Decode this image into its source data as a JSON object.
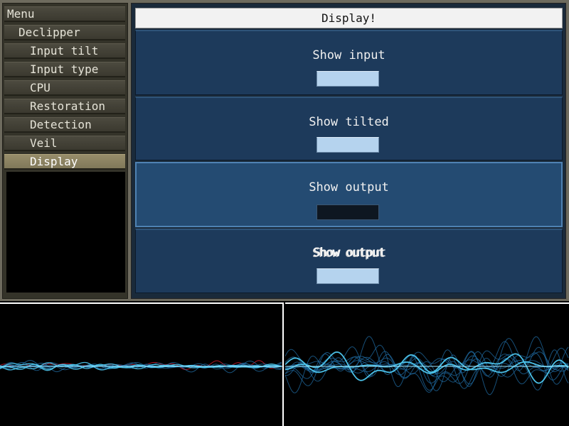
{
  "menu": {
    "items": [
      {
        "label": "Menu",
        "indent": 0,
        "selected": false
      },
      {
        "label": "Declipper",
        "indent": 1,
        "selected": false
      },
      {
        "label": "Input tilt",
        "indent": 2,
        "selected": false
      },
      {
        "label": "Input type",
        "indent": 2,
        "selected": false
      },
      {
        "label": "CPU",
        "indent": 2,
        "selected": false
      },
      {
        "label": "Restoration",
        "indent": 2,
        "selected": false
      },
      {
        "label": "Detection",
        "indent": 2,
        "selected": false
      },
      {
        "label": "Veil",
        "indent": 2,
        "selected": false
      },
      {
        "label": "Display",
        "indent": 2,
        "selected": true
      }
    ]
  },
  "panel": {
    "title": "Display!",
    "options": [
      {
        "label": "Show input",
        "checked": true,
        "selected": false
      },
      {
        "label": "Show tilted",
        "checked": true,
        "selected": false
      },
      {
        "label": "Show output",
        "checked": false,
        "selected": true
      },
      {
        "label": "Show output",
        "checked": true,
        "selected": false,
        "garbled": true
      }
    ]
  },
  "colors": {
    "menu_bg": "#3b392f",
    "menu_selected": "#8a8161",
    "panel_bg": "#1d3a5b",
    "toggle_on": "#b5d3ee",
    "toggle_off": "#0e1721",
    "wave_light": "#4ec8f0",
    "wave_dark": "#1f6aa0",
    "clip_red": "#c0182a"
  }
}
